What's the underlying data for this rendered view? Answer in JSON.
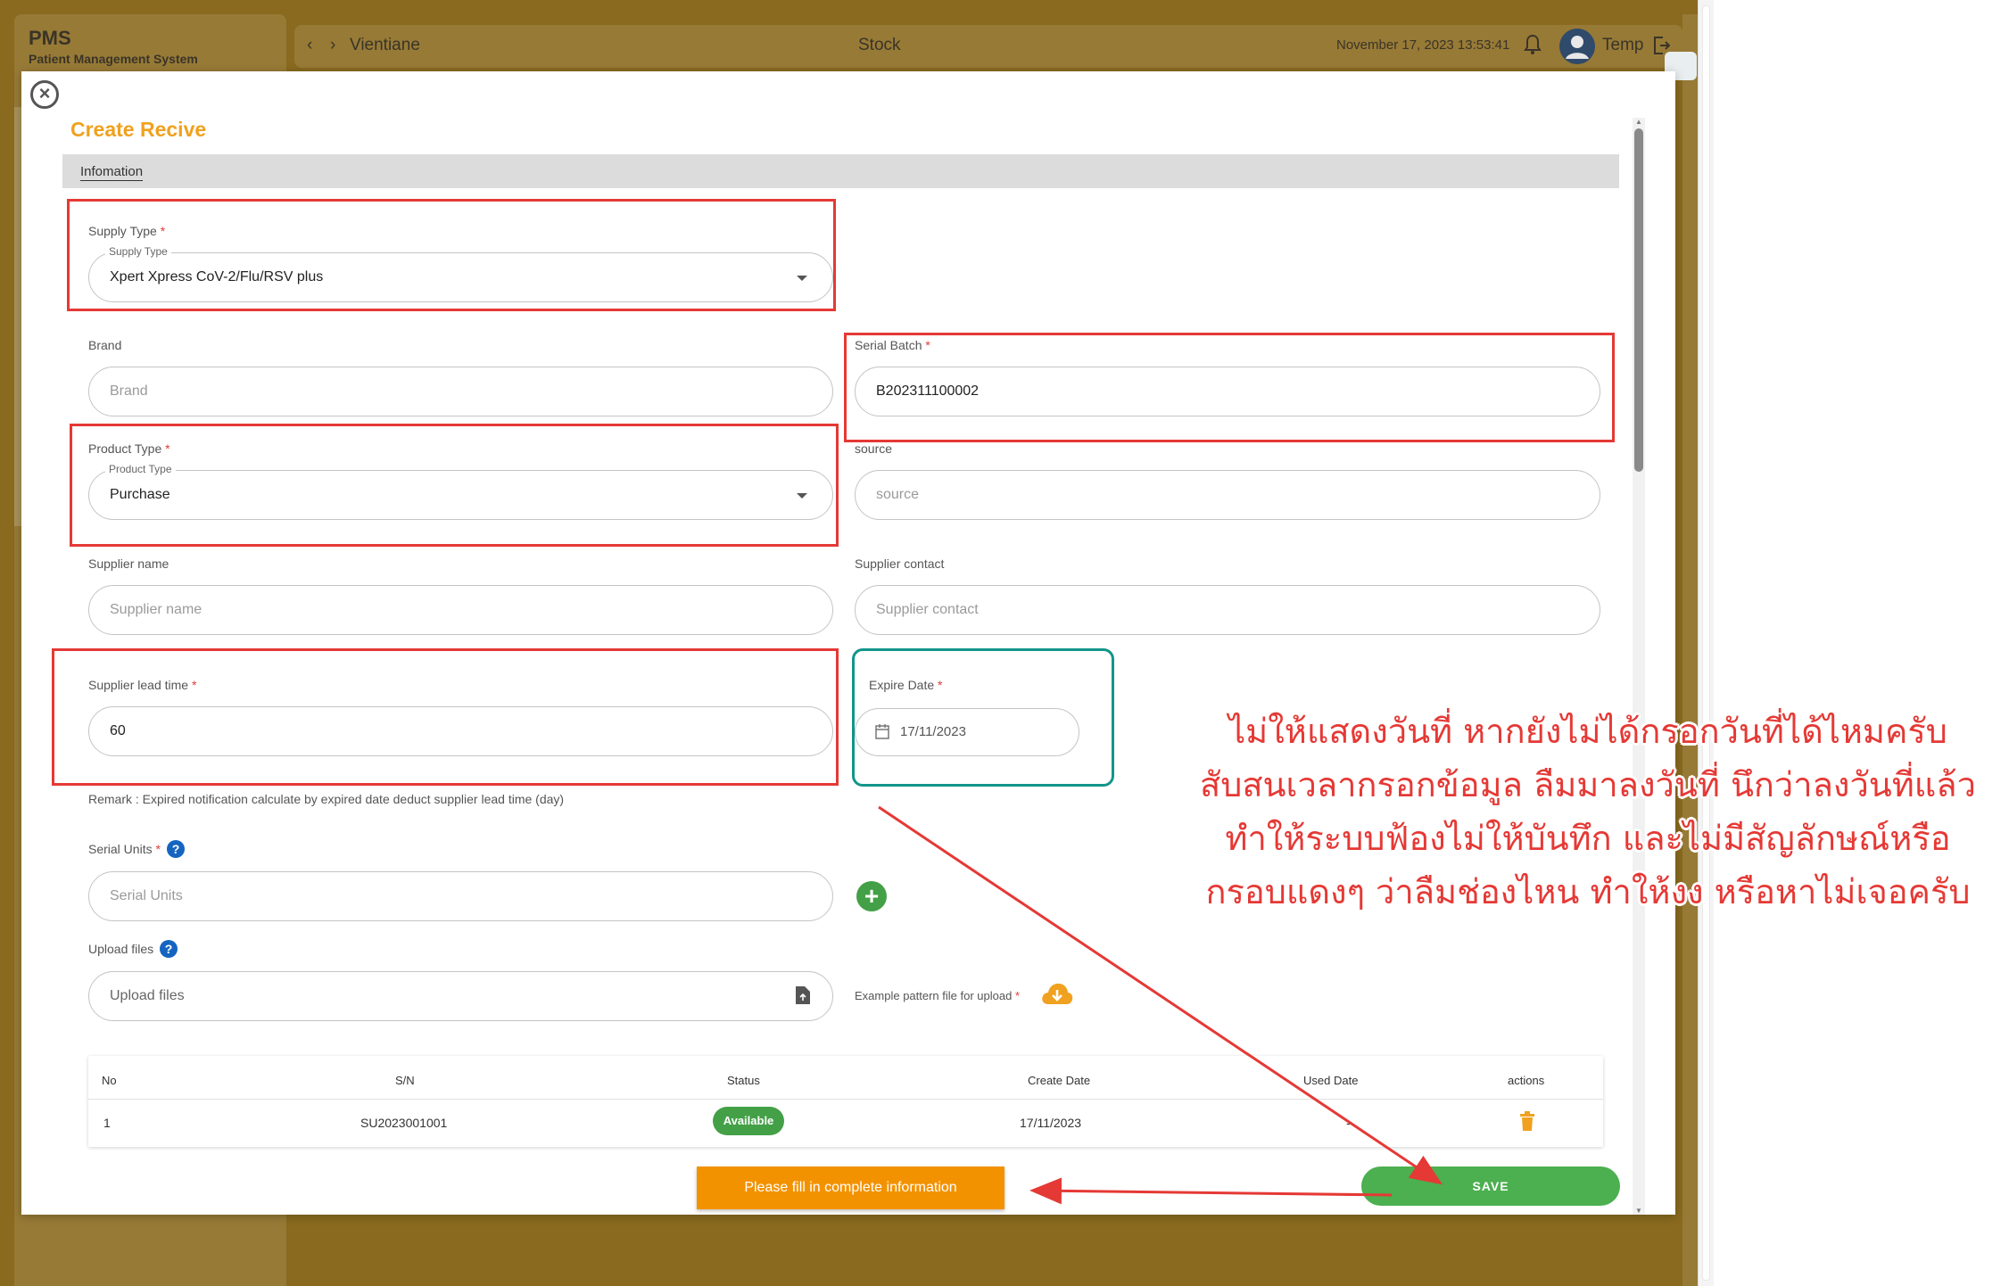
{
  "app": {
    "brand": "PMS",
    "subtitle": "Patient Management System"
  },
  "topbar": {
    "location": "Vientiane",
    "page": "Stock",
    "datetime": "November 17, 2023 13:53:41",
    "user": "Temp"
  },
  "modal": {
    "title": "Create Recive",
    "tab": "Infomation",
    "supply_type": {
      "label": "Supply Type",
      "legend": "Supply Type",
      "value": "Xpert Xpress CoV-2/Flu/RSV plus"
    },
    "brand": {
      "label": "Brand",
      "placeholder": "Brand"
    },
    "serial_batch": {
      "label": "Serial Batch",
      "value": "B202311100002"
    },
    "product_type": {
      "label": "Product Type",
      "legend": "Product Type",
      "value": "Purchase"
    },
    "source": {
      "label": "source",
      "placeholder": "source"
    },
    "supplier_name": {
      "label": "Supplier name",
      "placeholder": "Supplier name"
    },
    "supplier_contact": {
      "label": "Supplier contact",
      "placeholder": "Supplier contact"
    },
    "supplier_lead_time": {
      "label": "Supplier lead time",
      "value": "60"
    },
    "expire_date": {
      "label": "Expire Date",
      "value": "17/11/2023"
    },
    "remark": "Remark : Expired notification calculate by expired date deduct supplier lead time (day)",
    "serial_units": {
      "label": "Serial Units",
      "placeholder": "Serial Units"
    },
    "upload_files": {
      "label": "Upload files",
      "placeholder": "Upload files"
    },
    "example_pattern": "Example pattern file for upload",
    "table": {
      "headers": [
        "No",
        "S/N",
        "Status",
        "Create Date",
        "Used Date",
        "actions"
      ],
      "rows": [
        {
          "no": "1",
          "sn": "SU2023001001",
          "status": "Available",
          "create_date": "17/11/2023",
          "used_date": "-"
        }
      ]
    },
    "toast": "Please fill in complete information",
    "save": "SAVE"
  },
  "annotation": {
    "line1": "ไม่ให้แสดงวันที่ หากยังไม่ได้กรอกวันที่ได้ไหมครับ",
    "line2": "สับสนเวลากรอกข้อมูล ลืมมาลงวันที่ นึกว่าลงวันที่แล้ว",
    "line3": "ทำให้ระบบฟ้องไม่ให้บันทึก และไม่มีสัญลักษณ์หรือ",
    "line4": "กรอบแดงๆ ว่าลืมช่องไหน ทำให้งง หรือหาไม่เจอครับ"
  },
  "colors": {
    "accent": "#f0a11f",
    "required": "#e53935",
    "success": "#43a047",
    "toast": "#f39200",
    "annotation": "#e53935"
  }
}
